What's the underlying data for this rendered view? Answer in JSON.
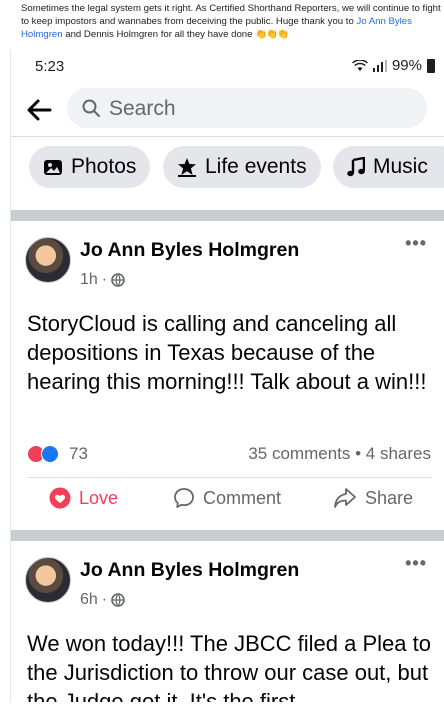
{
  "caption": {
    "text": "Sometimes the legal system gets it right. As Certified Shorthand Reporters, we will continue to fight to keep impostors and wannabes from deceiving the public. Huge thank you to ",
    "mention": "Jo Ann Byles Holmgren",
    "suffix": " and Dennis Holmgren for all they have done ",
    "emoji": "👏👏👏"
  },
  "status_bar": {
    "time": "5:23",
    "battery": "99%"
  },
  "search": {
    "placeholder": "Search"
  },
  "filters": [
    {
      "label": "Photos",
      "icon": "photo-icon"
    },
    {
      "label": "Life events",
      "icon": "star-icon"
    },
    {
      "label": "Music",
      "icon": "music-note-icon"
    }
  ],
  "posts": [
    {
      "author": "Jo Ann Byles Holmgren",
      "time": "1h",
      "audience_icon": "globe-icon",
      "text": "StoryCloud is calling and canceling all depositions in Texas because of the hearing this morning!!! Talk about a win!!!",
      "reactions": "73",
      "comments_shares": "35 comments • 4 shares",
      "actions": {
        "love": "Love",
        "comment": "Comment",
        "share": "Share"
      }
    },
    {
      "author": "Jo Ann Byles Holmgren",
      "time": "6h",
      "audience_icon": "globe-icon",
      "text": "We won today!!! The JBCC filed a Plea to the Jurisdiction to throw our case out, but the Judge got it. It's the first"
    }
  ],
  "colors": {
    "accent": "#1877f2",
    "love": "#f33e58",
    "muted": "#65676b",
    "link": "#216fdb"
  }
}
